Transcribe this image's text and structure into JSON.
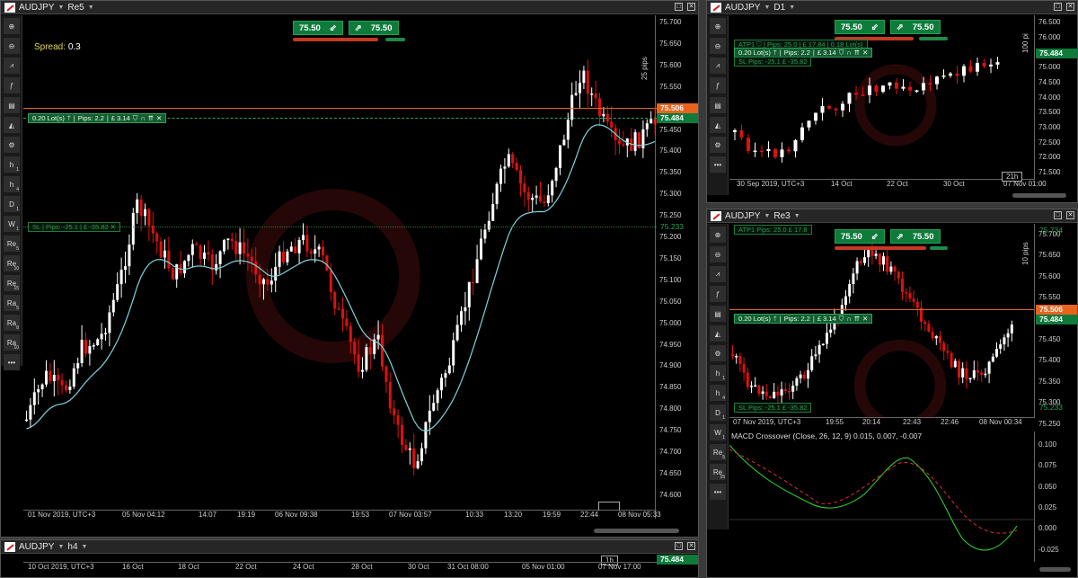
{
  "colors": {
    "bull": "#ffffff",
    "bear": "#dd1010",
    "ma": "#7fd4dc",
    "green": "#0e7b3b",
    "orange": "#e8641e"
  },
  "main": {
    "symbol": "AUDJPY",
    "timeframe": "Re5",
    "sell_price": "75.50",
    "sell_sup": "s",
    "buy_price": "75.50",
    "buy_sup": "s",
    "spread_label": "Spread:",
    "spread_value": "0.3",
    "position": {
      "lots": "0.20 Lot(s)",
      "pips": "Pips: 2.2",
      "pl": "£ 3.14"
    },
    "sl": {
      "label": "SL",
      "pips": "Pips: -25.1",
      "pl": "£ -35.82"
    },
    "ask": "75.506",
    "bid": "75.484",
    "sl_price": "75.233",
    "pips_note": "25 pips",
    "price_ticks": [
      "75.700",
      "75.650",
      "75.600",
      "75.550",
      "75.500",
      "75.450",
      "75.400",
      "75.350",
      "75.300",
      "75.250",
      "75.200",
      "75.150",
      "75.100",
      "75.050",
      "75.000",
      "74.950",
      "74.900",
      "74.850",
      "74.800",
      "74.750",
      "74.700",
      "74.650",
      "74.600"
    ],
    "time_ticks": [
      "01 Nov 2019, UTC+3",
      "05 Nov 04:12",
      "14:07",
      "19:19",
      "06 Nov 09:38",
      "19:53",
      "07 Nov 03:57",
      "10:33",
      "13:20",
      "19:59",
      "22:44",
      "08 Nov 05:33"
    ],
    "toolbar": [
      "h",
      "h",
      "D",
      "W",
      "Re",
      "Re",
      "Re",
      "Ra",
      "Ra",
      "Ra"
    ],
    "toolbar_sub": [
      "1",
      "4",
      "1",
      "1",
      "5",
      "10",
      "15",
      "5",
      "8",
      "10"
    ]
  },
  "d1": {
    "symbol": "AUDJPY",
    "timeframe": "D1",
    "sell_price": "75.50",
    "buy_price": "75.50",
    "atp": "ATP1",
    "atp_pips": "Pips: 25.0",
    "atp_pl": "£ 17.84",
    "atp_lots": "0.18 Lot(s)",
    "pos_lots": "0.20 Lot(s)",
    "pos_pips": "Pips: 2.2",
    "pos_pl": "£ 3.14",
    "sl_text": "SL   Pips: -25.1   £ -35.82",
    "bid": "75.484",
    "pips_note": "100 pi",
    "price_ticks": [
      "76.500",
      "76.000",
      "75.500",
      "75.000",
      "74.500",
      "74.000",
      "73.500",
      "73.000",
      "72.500",
      "72.000",
      "71.500"
    ],
    "time_ticks": [
      "30 Sep 2019, UTC+3",
      "14 Oct",
      "22 Oct",
      "30 Oct",
      "07 Nov 01:00"
    ],
    "countdown": "21h"
  },
  "re3": {
    "symbol": "AUDJPY",
    "timeframe": "Re3",
    "sell_price": "75.50",
    "buy_price": "75.50",
    "atp": "ATP1",
    "atp_text": "ATP1   Pips: 25.0   £ 17.8",
    "pos_lots": "0.20 Lot(s)",
    "pos_pips": "Pips: 2.2",
    "pos_pl": "£ 3.14",
    "sl_text": "SL   Pips: -25.1   £ -35.82",
    "ask": "75.506",
    "bid": "75.484",
    "tp_price": "75.734",
    "sl_price": "75.233",
    "pips_note": "10 pips",
    "price_ticks": [
      "75.700",
      "75.650",
      "75.600",
      "75.550",
      "75.500",
      "75.450",
      "75.400",
      "75.350",
      "75.300",
      "75.250"
    ],
    "time_ticks": [
      "07 Nov 2019, UTC+3",
      "19:55",
      "20:14",
      "22:43",
      "22:46",
      "08 Nov 00:34"
    ],
    "macd_label": "MACD Crossover (Close, 26, 12, 9) 0.015, 0.007, -0.007",
    "macd_ticks": [
      "0.100",
      "0.075",
      "0.050",
      "0.025",
      "0.000",
      "-0.025"
    ],
    "toolbar": [
      "h",
      "h",
      "D",
      "W",
      "Re",
      "Re"
    ],
    "toolbar_sub": [
      "1",
      "4",
      "1",
      "1",
      "5",
      "15"
    ]
  },
  "h4": {
    "symbol": "AUDJPY",
    "timeframe": "h4",
    "bid": "75.484",
    "countdown": "1h",
    "time_ticks": [
      "10 Oct 2019, UTC+3",
      "16 Oct",
      "18 Oct",
      "22 Oct",
      "24 Oct",
      "28 Oct",
      "30 Oct",
      "31 Oct 08:00",
      "05 Nov 01:00",
      "07 Nov 17:00"
    ]
  }
}
